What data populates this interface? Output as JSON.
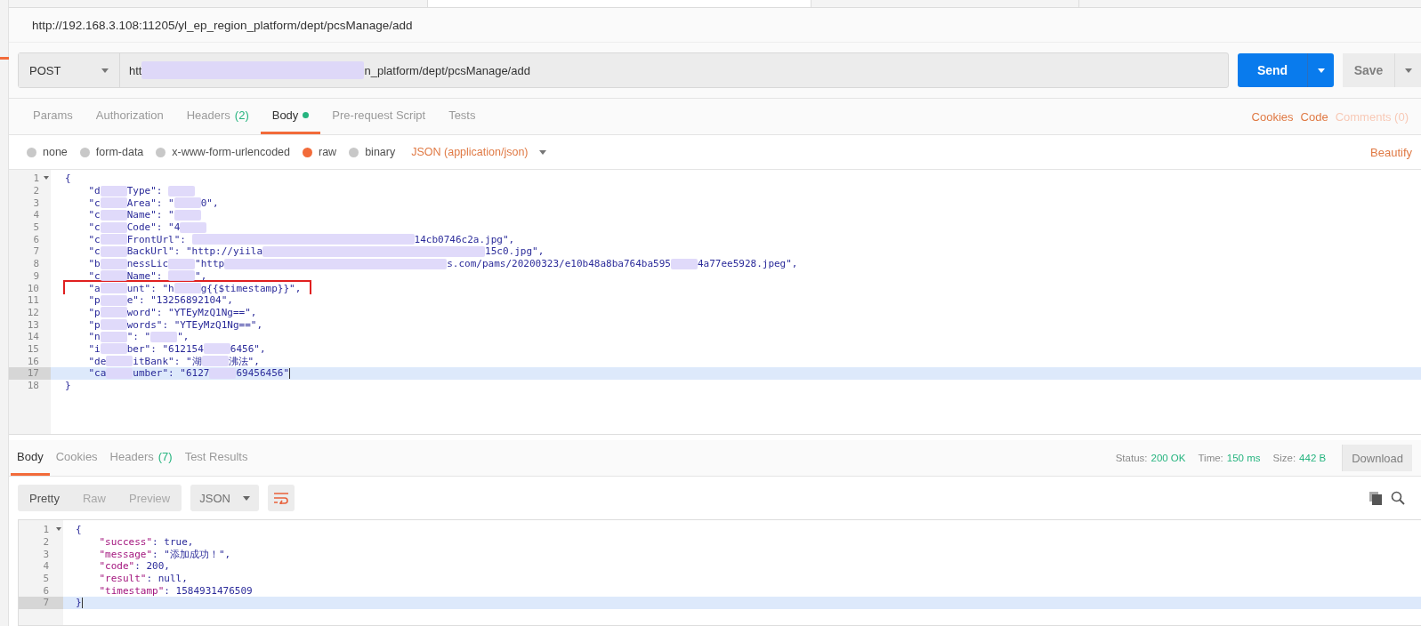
{
  "request_title": "http://192.168.3.108:11205/yl_ep_region_platform/dept/pcsManage/add",
  "request": {
    "method": "POST",
    "url_segments": [
      {
        "kind": "text",
        "text": "htt"
      },
      {
        "kind": "long_redacted"
      },
      {
        "kind": "text",
        "text": "n_platform/dept/pcsManage/add"
      }
    ]
  },
  "send_button": "Send",
  "save_button": "Save",
  "request_tabs": [
    {
      "label": "Params",
      "selected": false
    },
    {
      "label": "Authorization",
      "selected": false
    },
    {
      "label": "Headers",
      "count": "(2)",
      "selected": false
    },
    {
      "label": "Body",
      "dot": true,
      "selected": true
    },
    {
      "label": "Pre-request Script",
      "selected": false
    },
    {
      "label": "Tests",
      "selected": false
    }
  ],
  "request_links": [
    {
      "label": "Cookies",
      "disabled": false
    },
    {
      "label": "Code",
      "disabled": false
    },
    {
      "label": "Comments (0)",
      "disabled": true
    }
  ],
  "body_modes": [
    {
      "label": "none",
      "selected": false
    },
    {
      "label": "form-data",
      "selected": false
    },
    {
      "label": "x-www-form-urlencoded",
      "selected": false
    },
    {
      "label": "raw",
      "selected": true
    },
    {
      "label": "binary",
      "selected": false
    }
  ],
  "content_type": "JSON (application/json)",
  "beautify": "Beautify",
  "request_body": [
    {
      "number": "1",
      "fold": true,
      "highlighted": false,
      "boxed": false,
      "segments": [
        {
          "kind": "text",
          "text": "{"
        }
      ]
    },
    {
      "number": "2",
      "fold": false,
      "highlighted": false,
      "boxed": false,
      "segments": [
        {
          "kind": "text",
          "text": "    \"d"
        },
        {
          "kind": "redacted"
        },
        {
          "kind": "text",
          "text": "Type\": "
        },
        {
          "kind": "redacted"
        }
      ]
    },
    {
      "number": "3",
      "fold": false,
      "highlighted": false,
      "boxed": false,
      "segments": [
        {
          "kind": "text",
          "text": "    \"c"
        },
        {
          "kind": "redacted"
        },
        {
          "kind": "text",
          "text": "Area\": \""
        },
        {
          "kind": "redacted"
        },
        {
          "kind": "text",
          "text": "0\","
        }
      ]
    },
    {
      "number": "4",
      "fold": false,
      "highlighted": false,
      "boxed": false,
      "segments": [
        {
          "kind": "text",
          "text": "    \"c"
        },
        {
          "kind": "redacted"
        },
        {
          "kind": "text",
          "text": "Name\": \""
        },
        {
          "kind": "redacted"
        }
      ]
    },
    {
      "number": "5",
      "fold": false,
      "highlighted": false,
      "boxed": false,
      "segments": [
        {
          "kind": "text",
          "text": "    \"c"
        },
        {
          "kind": "redacted"
        },
        {
          "kind": "text",
          "text": "Code\": \"4"
        },
        {
          "kind": "redacted"
        }
      ]
    },
    {
      "number": "6",
      "fold": false,
      "highlighted": false,
      "boxed": false,
      "segments": [
        {
          "kind": "text",
          "text": "    \"c"
        },
        {
          "kind": "redacted"
        },
        {
          "kind": "text",
          "text": "FrontUrl\": "
        },
        {
          "kind": "long_redacted"
        },
        {
          "kind": "text",
          "text": "14cb0746c2a.jpg\","
        }
      ]
    },
    {
      "number": "7",
      "fold": false,
      "highlighted": false,
      "boxed": false,
      "segments": [
        {
          "kind": "text",
          "text": "    \"c"
        },
        {
          "kind": "redacted"
        },
        {
          "kind": "text",
          "text": "BackUrl\": \"http://yiila"
        },
        {
          "kind": "long_redacted"
        },
        {
          "kind": "text",
          "text": "15c0.jpg\","
        }
      ]
    },
    {
      "number": "8",
      "fold": false,
      "highlighted": false,
      "boxed": false,
      "segments": [
        {
          "kind": "text",
          "text": "    \"b"
        },
        {
          "kind": "redacted"
        },
        {
          "kind": "text",
          "text": "nessLic"
        },
        {
          "kind": "redacted"
        },
        {
          "kind": "text",
          "text": "\"http"
        },
        {
          "kind": "long_redacted"
        },
        {
          "kind": "text",
          "text": "s.com/pams/20200323/e10b48a8ba764ba595"
        },
        {
          "kind": "redacted"
        },
        {
          "kind": "text",
          "text": "4a77ee5928.jpeg\","
        }
      ]
    },
    {
      "number": "9",
      "fold": false,
      "highlighted": false,
      "boxed": false,
      "segments": [
        {
          "kind": "text",
          "text": "    \"c"
        },
        {
          "kind": "redacted"
        },
        {
          "kind": "text",
          "text": "Name\": "
        },
        {
          "kind": "redacted"
        },
        {
          "kind": "text",
          "text": "\","
        }
      ]
    },
    {
      "number": "10",
      "fold": false,
      "highlighted": false,
      "boxed": true,
      "segments": [
        {
          "kind": "text",
          "text": "    \"a"
        },
        {
          "kind": "redacted"
        },
        {
          "kind": "text",
          "text": "unt\": \"h"
        },
        {
          "kind": "redacted"
        },
        {
          "kind": "text",
          "text": "g{{$timestamp}}\","
        }
      ]
    },
    {
      "number": "11",
      "fold": false,
      "highlighted": false,
      "boxed": false,
      "segments": [
        {
          "kind": "text",
          "text": "    \"p"
        },
        {
          "kind": "redacted"
        },
        {
          "kind": "text",
          "text": "e\": \"13256892104\","
        }
      ]
    },
    {
      "number": "12",
      "fold": false,
      "highlighted": false,
      "boxed": false,
      "segments": [
        {
          "kind": "text",
          "text": "    \"p"
        },
        {
          "kind": "redacted"
        },
        {
          "kind": "text",
          "text": "word\": \"YTEyMzQ1Ng==\","
        }
      ]
    },
    {
      "number": "13",
      "fold": false,
      "highlighted": false,
      "boxed": false,
      "segments": [
        {
          "kind": "text",
          "text": "    \"p"
        },
        {
          "kind": "redacted"
        },
        {
          "kind": "text",
          "text": "words\": \"YTEyMzQ1Ng==\","
        }
      ]
    },
    {
      "number": "14",
      "fold": false,
      "highlighted": false,
      "boxed": false,
      "segments": [
        {
          "kind": "text",
          "text": "    \"n"
        },
        {
          "kind": "redacted"
        },
        {
          "kind": "text",
          "text": "\": \""
        },
        {
          "kind": "redacted"
        },
        {
          "kind": "text",
          "text": "\","
        }
      ]
    },
    {
      "number": "15",
      "fold": false,
      "highlighted": false,
      "boxed": false,
      "segments": [
        {
          "kind": "text",
          "text": "    \"i"
        },
        {
          "kind": "redacted"
        },
        {
          "kind": "text",
          "text": "ber\": \"612154"
        },
        {
          "kind": "redacted"
        },
        {
          "kind": "text",
          "text": "6456\","
        }
      ]
    },
    {
      "number": "16",
      "fold": false,
      "highlighted": false,
      "boxed": false,
      "segments": [
        {
          "kind": "text",
          "text": "    \"de"
        },
        {
          "kind": "redacted"
        },
        {
          "kind": "text",
          "text": "itBank\": \"湖"
        },
        {
          "kind": "redacted"
        },
        {
          "kind": "text",
          "text": "沸法\","
        }
      ]
    },
    {
      "number": "17",
      "fold": false,
      "highlighted": true,
      "boxed": false,
      "segments": [
        {
          "kind": "text",
          "text": "    \"ca"
        },
        {
          "kind": "redacted"
        },
        {
          "kind": "text",
          "text": "umber\": \"6127"
        },
        {
          "kind": "redacted"
        },
        {
          "kind": "text",
          "text": "69456456\""
        }
      ]
    },
    {
      "number": "18",
      "fold": false,
      "highlighted": false,
      "boxed": false,
      "segments": [
        {
          "kind": "text",
          "text": "}"
        }
      ]
    }
  ],
  "response_tabs": [
    {
      "label": "Body",
      "selected": true
    },
    {
      "label": "Cookies",
      "selected": false
    },
    {
      "label": "Headers",
      "count": "(7)",
      "selected": false
    },
    {
      "label": "Test Results",
      "selected": false
    }
  ],
  "response_stats": [
    {
      "label": "Status:",
      "value": "200 OK"
    },
    {
      "label": "Time:",
      "value": "150 ms"
    },
    {
      "label": "Size:",
      "value": "442 B"
    }
  ],
  "download_button": "Download",
  "view_modes": [
    {
      "label": "Pretty",
      "selected": true
    },
    {
      "label": "Raw",
      "selected": false
    },
    {
      "label": "Preview",
      "selected": false
    }
  ],
  "format_select": "JSON",
  "response_body": [
    {
      "number": "1",
      "fold": true,
      "highlighted": false,
      "segments": [
        {
          "kind": "text",
          "text": "{"
        }
      ]
    },
    {
      "number": "2",
      "fold": false,
      "highlighted": false,
      "segments": [
        {
          "kind": "key",
          "text": "    \"success\""
        },
        {
          "kind": "text",
          "text": ": true,"
        }
      ]
    },
    {
      "number": "3",
      "fold": false,
      "highlighted": false,
      "segments": [
        {
          "kind": "key",
          "text": "    \"message\""
        },
        {
          "kind": "text",
          "text": ": \"添加成功！\","
        }
      ]
    },
    {
      "number": "4",
      "fold": false,
      "highlighted": false,
      "segments": [
        {
          "kind": "key",
          "text": "    \"code\""
        },
        {
          "kind": "text",
          "text": ": 200,"
        }
      ]
    },
    {
      "number": "5",
      "fold": false,
      "highlighted": false,
      "segments": [
        {
          "kind": "key",
          "text": "    \"result\""
        },
        {
          "kind": "text",
          "text": ": null,"
        }
      ]
    },
    {
      "number": "6",
      "fold": false,
      "highlighted": false,
      "segments": [
        {
          "kind": "key",
          "text": "    \"timestamp\""
        },
        {
          "kind": "text",
          "text": ": 1584931476509"
        }
      ]
    },
    {
      "number": "7",
      "fold": false,
      "highlighted": true,
      "segments": [
        {
          "kind": "text",
          "text": "}"
        }
      ]
    }
  ]
}
